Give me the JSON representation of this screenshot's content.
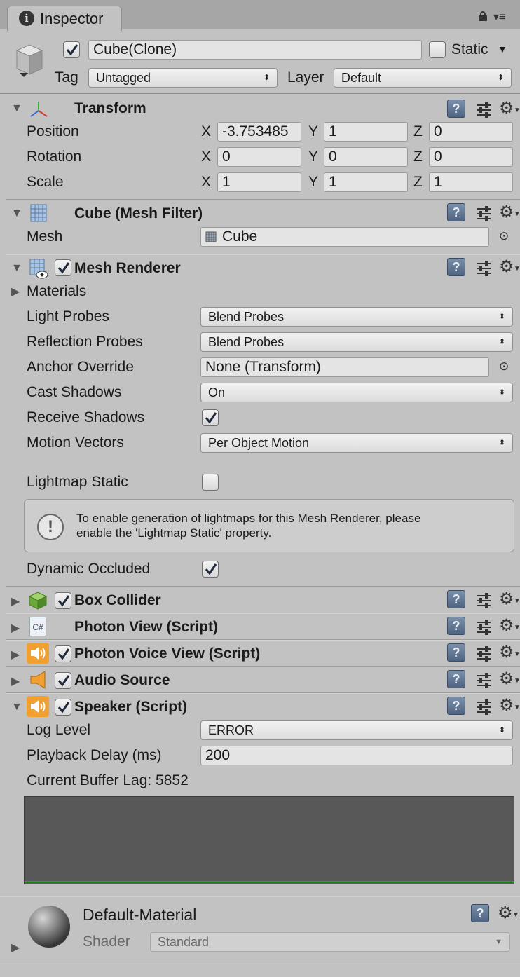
{
  "tab": {
    "title": "Inspector"
  },
  "header": {
    "object_name": "Cube(Clone)",
    "static_label": "Static",
    "tag_label": "Tag",
    "tag_value": "Untagged",
    "layer_label": "Layer",
    "layer_value": "Default"
  },
  "transform": {
    "title": "Transform",
    "rows": [
      {
        "label": "Position",
        "x": "-3.753485",
        "y": "1",
        "z": "0"
      },
      {
        "label": "Rotation",
        "x": "0",
        "y": "0",
        "z": "0"
      },
      {
        "label": "Scale",
        "x": "1",
        "y": "1",
        "z": "1"
      }
    ],
    "axis": {
      "x": "X",
      "y": "Y",
      "z": "Z"
    }
  },
  "mesh_filter": {
    "title": "Cube (Mesh Filter)",
    "mesh_label": "Mesh",
    "mesh_value": "Cube"
  },
  "mesh_renderer": {
    "title": "Mesh Renderer",
    "materials": "Materials",
    "light_probes_label": "Light Probes",
    "light_probes_value": "Blend Probes",
    "reflection_probes_label": "Reflection Probes",
    "reflection_probes_value": "Blend Probes",
    "anchor_label": "Anchor Override",
    "anchor_value": "None (Transform)",
    "cast_shadows_label": "Cast Shadows",
    "cast_shadows_value": "On",
    "receive_shadows_label": "Receive Shadows",
    "motion_vectors_label": "Motion Vectors",
    "motion_vectors_value": "Per Object Motion",
    "lightmap_static_label": "Lightmap Static",
    "help_line1": "To enable generation of lightmaps for this Mesh Renderer, please",
    "help_line2": "enable the 'Lightmap Static' property.",
    "dynamic_occluded_label": "Dynamic Occluded"
  },
  "components": {
    "box_collider": "Box Collider",
    "photon_view": "Photon View (Script)",
    "photon_voice_view": "Photon Voice View (Script)",
    "audio_source": "Audio Source",
    "speaker": "Speaker (Script)"
  },
  "speaker": {
    "log_level_label": "Log Level",
    "log_level_value": "ERROR",
    "playback_delay_label": "Playback Delay (ms)",
    "playback_delay_value": "200",
    "buffer_lag": "Current Buffer Lag: 5852"
  },
  "material": {
    "name": "Default-Material",
    "shader_label": "Shader",
    "shader_value": "Standard"
  },
  "icons": {
    "csharp": "C#",
    "help": "?",
    "info": "i",
    "warning": "!"
  },
  "colors": {
    "panel_bg": "#c2c2c2",
    "checkbox_check": "#1e2a3a",
    "graph_bg": "#585858",
    "graph_line": "#29a329"
  }
}
